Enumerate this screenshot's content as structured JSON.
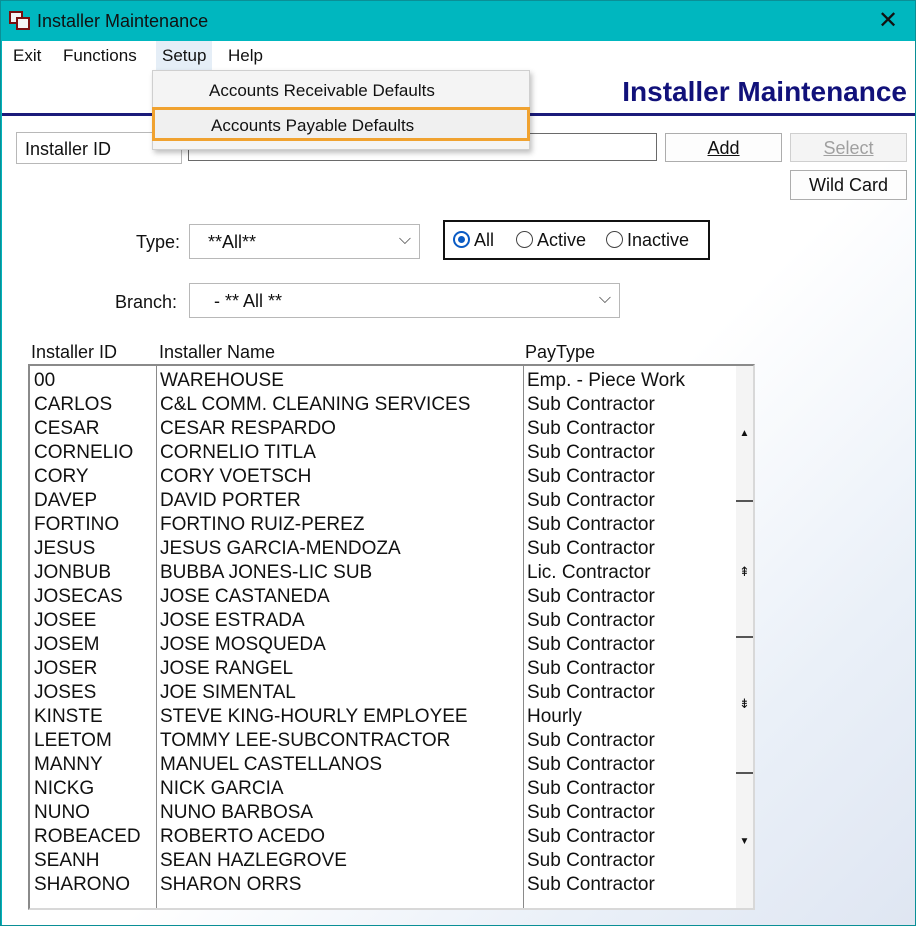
{
  "window": {
    "title": "Installer Maintenance",
    "close_label": "✕"
  },
  "menu": {
    "items": [
      "Exit",
      "Functions",
      "Setup",
      "Help"
    ]
  },
  "setup_menu": {
    "items": [
      "Accounts Receivable Defaults",
      "Accounts Payable Defaults"
    ]
  },
  "header": {
    "title": "Installer Maintenance"
  },
  "search": {
    "field_select": "Installer ID",
    "value": "",
    "add_label": "Add",
    "select_label": "Select",
    "wildcard_label": "Wild Card"
  },
  "filters": {
    "type_label": "Type:",
    "type_value": "**All**",
    "branch_label": "Branch:",
    "branch_value": "- ** All **",
    "status_options": [
      "All",
      "Active",
      "Inactive"
    ],
    "status_selected": "All"
  },
  "list": {
    "headers": [
      "Installer ID",
      "Installer Name",
      "PayType"
    ],
    "rows": [
      [
        "00",
        "WAREHOUSE",
        "Emp. - Piece Work"
      ],
      [
        "CARLOS",
        "C&L COMM. CLEANING SERVICES",
        "Sub Contractor"
      ],
      [
        "CESAR",
        "CESAR RESPARDO",
        "Sub Contractor"
      ],
      [
        "CORNELIO",
        "CORNELIO TITLA",
        "Sub Contractor"
      ],
      [
        "CORY",
        "CORY VOETSCH",
        "Sub Contractor"
      ],
      [
        "DAVEP",
        "DAVID PORTER",
        "Sub Contractor"
      ],
      [
        "FORTINO",
        "FORTINO RUIZ-PEREZ",
        "Sub Contractor"
      ],
      [
        "JESUS",
        "JESUS GARCIA-MENDOZA",
        "Sub Contractor"
      ],
      [
        "JONBUB",
        "BUBBA JONES-LIC SUB",
        "Lic. Contractor"
      ],
      [
        "JOSECAS",
        "JOSE CASTANEDA",
        "Sub Contractor"
      ],
      [
        "JOSEE",
        "JOSE ESTRADA",
        "Sub Contractor"
      ],
      [
        "JOSEM",
        "JOSE MOSQUEDA",
        "Sub Contractor"
      ],
      [
        "JOSER",
        "JOSE RANGEL",
        "Sub Contractor"
      ],
      [
        "JOSES",
        "JOE SIMENTAL",
        "Sub Contractor"
      ],
      [
        "KINSTE",
        "STEVE KING-HOURLY EMPLOYEE",
        "Hourly"
      ],
      [
        "LEETOM",
        "TOMMY LEE-SUBCONTRACTOR",
        "Sub Contractor"
      ],
      [
        "MANNY",
        "MANUEL CASTELLANOS",
        "Sub Contractor"
      ],
      [
        "NICKG",
        "NICK GARCIA",
        "Sub Contractor"
      ],
      [
        "NUNO",
        "NUNO BARBOSA",
        "Sub Contractor"
      ],
      [
        "ROBEACED",
        "ROBERTO ACEDO",
        "Sub Contractor"
      ],
      [
        "SEANH",
        "SEAN HAZLEGROVE",
        "Sub Contractor"
      ],
      [
        "SHARONO",
        "SHARON ORRS",
        "Sub Contractor"
      ]
    ]
  },
  "scroll": {
    "up": "▲",
    "page_up": "⇞",
    "page_down": "⇟",
    "down": "▼"
  }
}
